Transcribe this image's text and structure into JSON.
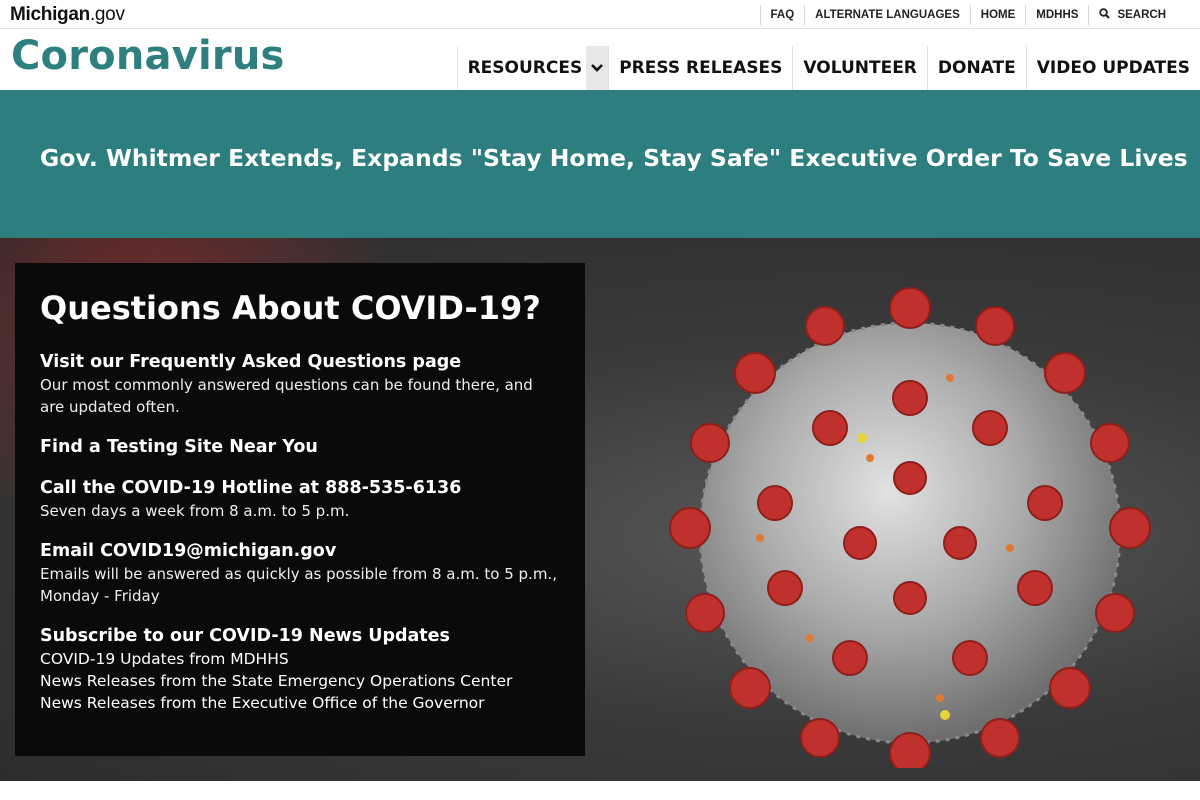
{
  "site": {
    "logo_main": "Michigan",
    "logo_suffix": ".gov",
    "title": "Coronavirus"
  },
  "utility_nav": [
    {
      "label": "FAQ"
    },
    {
      "label": "ALTERNATE LANGUAGES"
    },
    {
      "label": "HOME"
    },
    {
      "label": "MDHHS"
    },
    {
      "label": "SEARCH",
      "icon": "search-icon"
    }
  ],
  "main_nav": [
    {
      "label": "RESOURCES",
      "icon": "chevron-down-icon"
    },
    {
      "label": "PRESS RELEASES"
    },
    {
      "label": "VOLUNTEER"
    },
    {
      "label": "DONATE"
    },
    {
      "label": "VIDEO UPDATES"
    }
  ],
  "banner": {
    "headline": "Gov. Whitmer Extends, Expands \"Stay Home, Stay Safe\" Executive Order To Save Lives"
  },
  "info_box": {
    "title": "Questions About COVID-19?",
    "faq": {
      "heading": "Visit our Frequently Asked Questions page",
      "text": "Our most commonly answered questions can be found there, and are updated often."
    },
    "testing": {
      "heading": "Find a Testing Site Near You"
    },
    "hotline": {
      "heading": "Call the COVID-19 Hotline at 888-535-6136",
      "text": "Seven days a week from 8 a.m. to 5 p.m."
    },
    "email": {
      "heading": "Email COVID19@michigan.gov",
      "text": "Emails will be answered as quickly as possible from 8 a.m. to 5 p.m., Monday - Friday"
    },
    "subscribe": {
      "heading": "Subscribe to our COVID-19 News Updates",
      "links": [
        "COVID-19 Updates from MDHHS",
        "News Releases from the State Emergency Operations Center",
        "News Releases from the Executive Office of the Governor"
      ]
    }
  },
  "colors": {
    "brand_teal": "#2e7f7f",
    "banner_teal": "#2d7e7e",
    "virus_red": "#c0302c"
  }
}
